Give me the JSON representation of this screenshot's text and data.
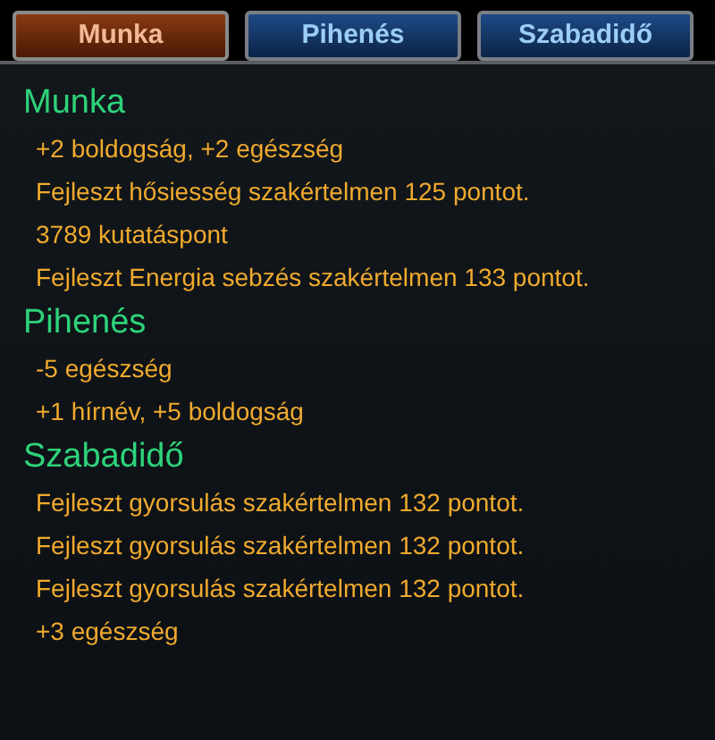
{
  "tabs": [
    {
      "label": "Munka",
      "selected": true
    },
    {
      "label": "Pihenés",
      "selected": false
    },
    {
      "label": "Szabadidő",
      "selected": false
    }
  ],
  "sections": [
    {
      "title": "Munka",
      "lines": [
        "+2 boldogság, +2 egészség",
        "Fejleszt hősiesség szakértelmen 125 pontot.",
        "3789 kutatáspont",
        "Fejleszt Energia sebzés szakértelmen 133 pontot."
      ]
    },
    {
      "title": "Pihenés",
      "lines": [
        "-5 egészség",
        "+1 hírnév, +5 boldogság"
      ]
    },
    {
      "title": "Szabadidő",
      "lines": [
        "Fejleszt gyorsulás szakértelmen 132 pontot.",
        "Fejleszt gyorsulás szakértelmen 132 pontot.",
        "Fejleszt gyorsulás szakértelmen 132 pontot.",
        "+3 egészség"
      ]
    }
  ]
}
